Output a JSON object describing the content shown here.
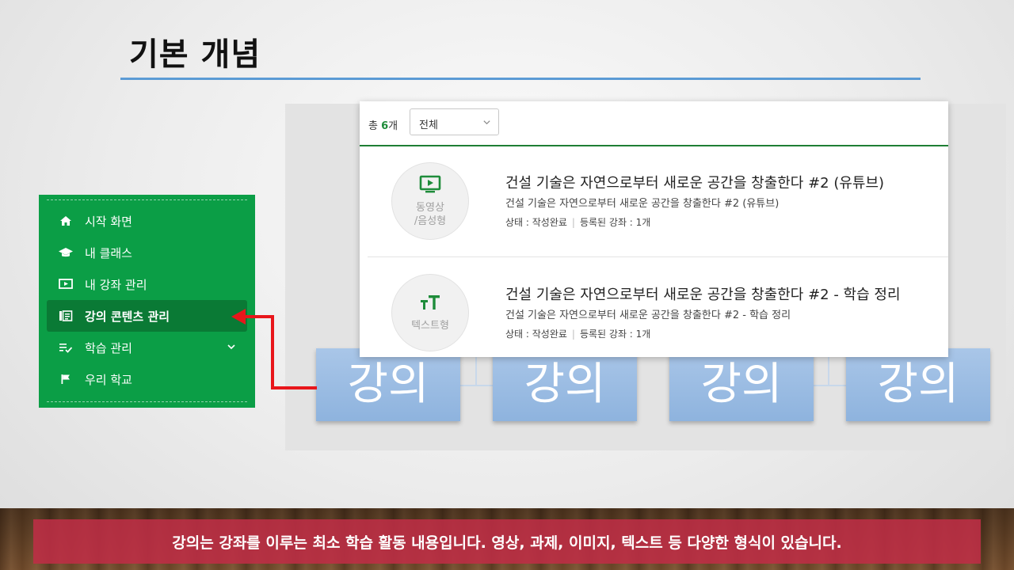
{
  "slide": {
    "title": "기본 개념",
    "caption": "강의는 강좌를 이루는 최소 학습 활동 내용입니다. 영상, 과제, 이미지, 텍스트 등 다양한 형식이 있습니다."
  },
  "diagram": {
    "boxes": [
      "강의",
      "강의",
      "강의",
      "강의"
    ]
  },
  "sidebar": {
    "items": [
      {
        "label": "시작 화면",
        "icon": "home-icon"
      },
      {
        "label": "내 클래스",
        "icon": "graduation-cap-icon"
      },
      {
        "label": "내 강좌 관리",
        "icon": "video-screen-icon"
      },
      {
        "label": "강의 콘텐츠 관리",
        "icon": "content-list-icon",
        "active": true
      },
      {
        "label": "학습 관리",
        "icon": "checklist-icon",
        "expandable": true
      },
      {
        "label": "우리 학교",
        "icon": "flag-icon"
      }
    ]
  },
  "panel": {
    "total_prefix": "총 ",
    "total_count": "6",
    "total_suffix": "개",
    "filter": {
      "selected": "전체"
    },
    "items": [
      {
        "type_line1": "동영상",
        "type_line2": "/음성형",
        "type_icon": "video-play-icon",
        "title": "건설 기술은 자연으로부터 새로운 공간을 창출한다 #2 (유튜브)",
        "subtitle": "건설 기술은 자연으로부터 새로운 공간을 창출한다 #2 (유튜브)",
        "status_label": "상태 : 작성완료",
        "registered_label": "등록된 강좌 : 1개"
      },
      {
        "type_line1": "텍스트형",
        "type_icon": "text-size-icon",
        "title": "건설 기술은 자연으로부터 새로운 공간을 창출한다 #2 - 학습 정리",
        "subtitle": "건설 기술은 자연으로부터 새로운 공간을 창출한다 #2 - 학습 정리",
        "status_label": "상태 : 작성완료",
        "registered_label": "등록된 강좌 : 1개"
      }
    ]
  },
  "colors": {
    "sidebar_bg": "#0b9e46",
    "sidebar_active": "#0a7a35",
    "accent_green": "#1e8c3a",
    "arrow_red": "#e8161b",
    "title_rule": "#5b9bd5",
    "lecture_box": "#8eb3de",
    "caption_bg": "#be2d46"
  }
}
